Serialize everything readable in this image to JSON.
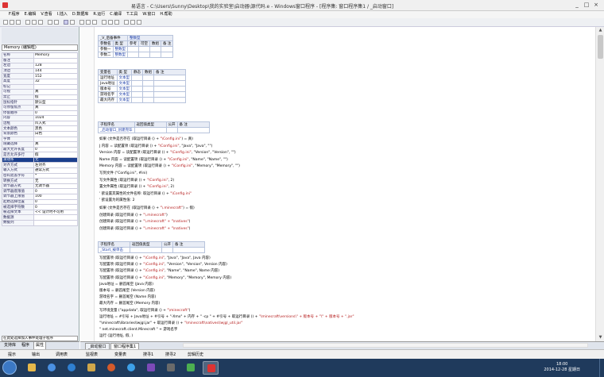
{
  "window": {
    "title": "易语言 - C:\\Users\\Sunny\\Desktop\\我的实验室\\启动器\\源代码.e - Windows窗口程序 - [程序集: 窗口程序集1 / _启动窗口]",
    "controls": [
      "_",
      "□",
      "×"
    ]
  },
  "menu": [
    "F.程序",
    "E.编辑",
    "V.查看",
    "I.插入",
    "D.数据库",
    "R.运行",
    "C.编译",
    "T.工具",
    "W.窗口",
    "H.帮助"
  ],
  "left_panel": {
    "selector": "Memory (编辑框)",
    "properties": [
      [
        "名称",
        "Memory"
      ],
      [
        "备注",
        ""
      ],
      [
        "左边",
        "128"
      ],
      [
        "顶边",
        "144"
      ],
      [
        "宽度",
        "152"
      ],
      [
        "高度",
        "32"
      ],
      [
        "标记",
        ""
      ],
      [
        "可视",
        "真"
      ],
      [
        "禁止",
        "假"
      ],
      [
        "鼠标指针",
        "默认型"
      ],
      [
        "可停留焦点",
        "真"
      ],
      [
        "停留顺序",
        "0"
      ],
      [
        "内容",
        "1024"
      ],
      [
        "边框",
        "凹入式"
      ],
      [
        "文本颜色",
        "黑色"
      ],
      [
        "背景颜色",
        "白色"
      ],
      [
        "字体",
        ""
      ],
      [
        "隐藏选择",
        "真"
      ],
      [
        "最大允许长度",
        "0"
      ],
      [
        "是否允许多行",
        "假"
      ],
      [
        "滚动条",
        "无"
      ],
      [
        "对齐方式",
        "左对齐"
      ],
      [
        "输入方式",
        "通常方式"
      ],
      [
        "密码遮盖字符",
        "*"
      ],
      [
        "转换方式",
        "无"
      ],
      [
        "调节器方式",
        "无调节器"
      ],
      [
        "调节器底限值",
        "0"
      ],
      [
        "调节器上限值",
        "100"
      ],
      [
        "起始选择位置",
        "0"
      ],
      [
        "被选择字符数",
        "0"
      ],
      [
        "被选择文本",
        "<< 设计时不可用"
      ],
      [
        "数据源",
        ""
      ],
      [
        "数据列",
        ""
      ]
    ],
    "selected_row": 20,
    "event_combo": "在此处选择加入事件处理子程序",
    "tabs": [
      "支持库",
      "程序",
      "属性"
    ]
  },
  "params_table": {
    "header": [
      "_V_后备事件",
      "整数型"
    ],
    "cols": [
      "参数名",
      "类 型",
      "参考",
      "可空",
      "数组",
      "备 注"
    ],
    "rows": [
      [
        "参数一",
        "整数型"
      ],
      [
        "参数二",
        "整数型"
      ]
    ]
  },
  "vars_table": {
    "cols": [
      "变量名",
      "类 型",
      "静态",
      "数组",
      "备 注"
    ],
    "rows": [
      [
        "运行地址",
        "文本型"
      ],
      [
        "Java地址",
        "文本型"
      ],
      [
        "版本号",
        "文本型"
      ],
      [
        "游戏名字",
        "文本型"
      ],
      [
        "最大内存",
        "文本型"
      ]
    ]
  },
  "sub1": {
    "cols": [
      "子程序名",
      "返回值类型",
      "公开",
      "备 注"
    ],
    "name": "_启动窗口_创建完毕"
  },
  "code1": [
    [
      "如果 (文件是否存在 (取运行目录 () + ",
      "\"\\Config.ini\"",
      ") = 真)"
    ],
    [
      "J 内容 = 读配置项 (取运行目录 () + ",
      "\"\\Config.ini\"",
      ", \"Java\", \"Java\", \"\")"
    ],
    [
      "Version 内容 = 读配置项 (取运行目录 () + ",
      "\"\\Config.ini\"",
      ", \"Version\", \"Version\", \"\")"
    ],
    [
      "Name 内容 = 读配置项 (取运行目录 () + ",
      "\"\\Config.ini\"",
      ", \"Name\", \"Name\", \"\")"
    ],
    [
      "Memory 内容 = 读配置项 (取运行目录 () + ",
      "\"\\Config.ini\"",
      ", \"Memory\", \"Memory\", \"\")"
    ],
    [
      "写到文件 (\"Config.ini\", #ini)",
      "",
      ""
    ],
    [
      "写文件属性 (取运行目录 () + ",
      "\"\\Config.ini\"",
      ", 2)"
    ],
    [
      "置文件属性 (取运行目录 () + ",
      "\"\\Config.ini\"",
      ", 2)"
    ],
    [
      "' 欲设置其属性的文件名称: 取运行目录 () + ",
      "\"\\Config.ini\"",
      ""
    ],
    [
      "' 欲设置为的属性值: 2",
      "",
      ""
    ]
  ],
  "code2": [
    [
      "如果 (文件是否存在 (取运行目录 () + ",
      "\"\\.minecraft\"",
      ") = 假)"
    ],
    [
      "创建目录 (取运行目录 () + ",
      "\"\\.minecraft\"",
      ")"
    ],
    [
      "创建目录 (取运行目录 () + ",
      "\"\\.minecraft\" + \"\\natives\"",
      ")"
    ],
    [
      "创建目录 (取运行目录 () + ",
      "\"\\.minecraft\" + \"\\natives\"",
      ")"
    ]
  ],
  "sub2": {
    "cols": [
      "子程序名",
      "返回值类型",
      "公开",
      "备 注"
    ],
    "name": "_Start_被单击"
  },
  "code3": [
    [
      "写配置项 (取运行目录 () + ",
      "\"\\Config.ini\"",
      ", \"Java\", \"Java\", Java 内容)"
    ],
    [
      "写配置项 (取运行目录 () + ",
      "\"\\Config.ini\"",
      ", \"Version\", \"Version\", Version 内容)"
    ],
    [
      "写配置项 (取运行目录 () + ",
      "\"\\Config.ini\"",
      ", \"Name\", \"Name\", Name 内容)"
    ],
    [
      "写配置项 (取运行目录 () + ",
      "\"\\Config.ini\"",
      ", \"Memory\", \"Memory\", Memory 内容)"
    ],
    [
      "Java地址 = 删首尾空 (Java 内容)",
      "",
      ""
    ],
    [
      "版本号 = 删首尾空 (Version 内容)",
      "",
      ""
    ],
    [
      "游戏名字 = 删首尾空 (Name 内容)",
      "",
      ""
    ],
    [
      "最大内存 = 删首尾空 (Memory 内容)",
      "",
      ""
    ],
    [
      "写环境变量 (\"appdata\", 取运行目录 () + ",
      "\"\\minecraft\"",
      ")"
    ],
    [
      "运行地址 = #引号 + Java地址 + #引号 + \"-Xmx\" + 内存 + \" -cp \" + #引号 + 取运行目录 () + ",
      "\"\\minecraft\\versions\\\" + 版本号 + \"\\\" + 版本号 + \".jar\"",
      ""
    ],
    [
      "    \"\\minecraft\\libraries\\lwjgl.jar\" + 取运行目录 () + ",
      "\"\\minecraft\\natives\\lwjgl_util.jar\"",
      ""
    ],
    [
      "    \" net.minecraft.client.Minecraft \" + 游戏名字",
      "",
      ""
    ],
    [
      "运行 (运行地址, 假, )",
      "",
      ""
    ]
  ],
  "code_tabs": [
    "_启动窗口",
    "窗口程序集1"
  ],
  "output_tabs": [
    "提示",
    "输出",
    "调用表",
    "监视表",
    "变量表",
    "搜寻1",
    "搜寻2",
    "剪辑历史"
  ],
  "taskbar": {
    "time": "18:00",
    "date": "2014-12-28 星期日"
  }
}
